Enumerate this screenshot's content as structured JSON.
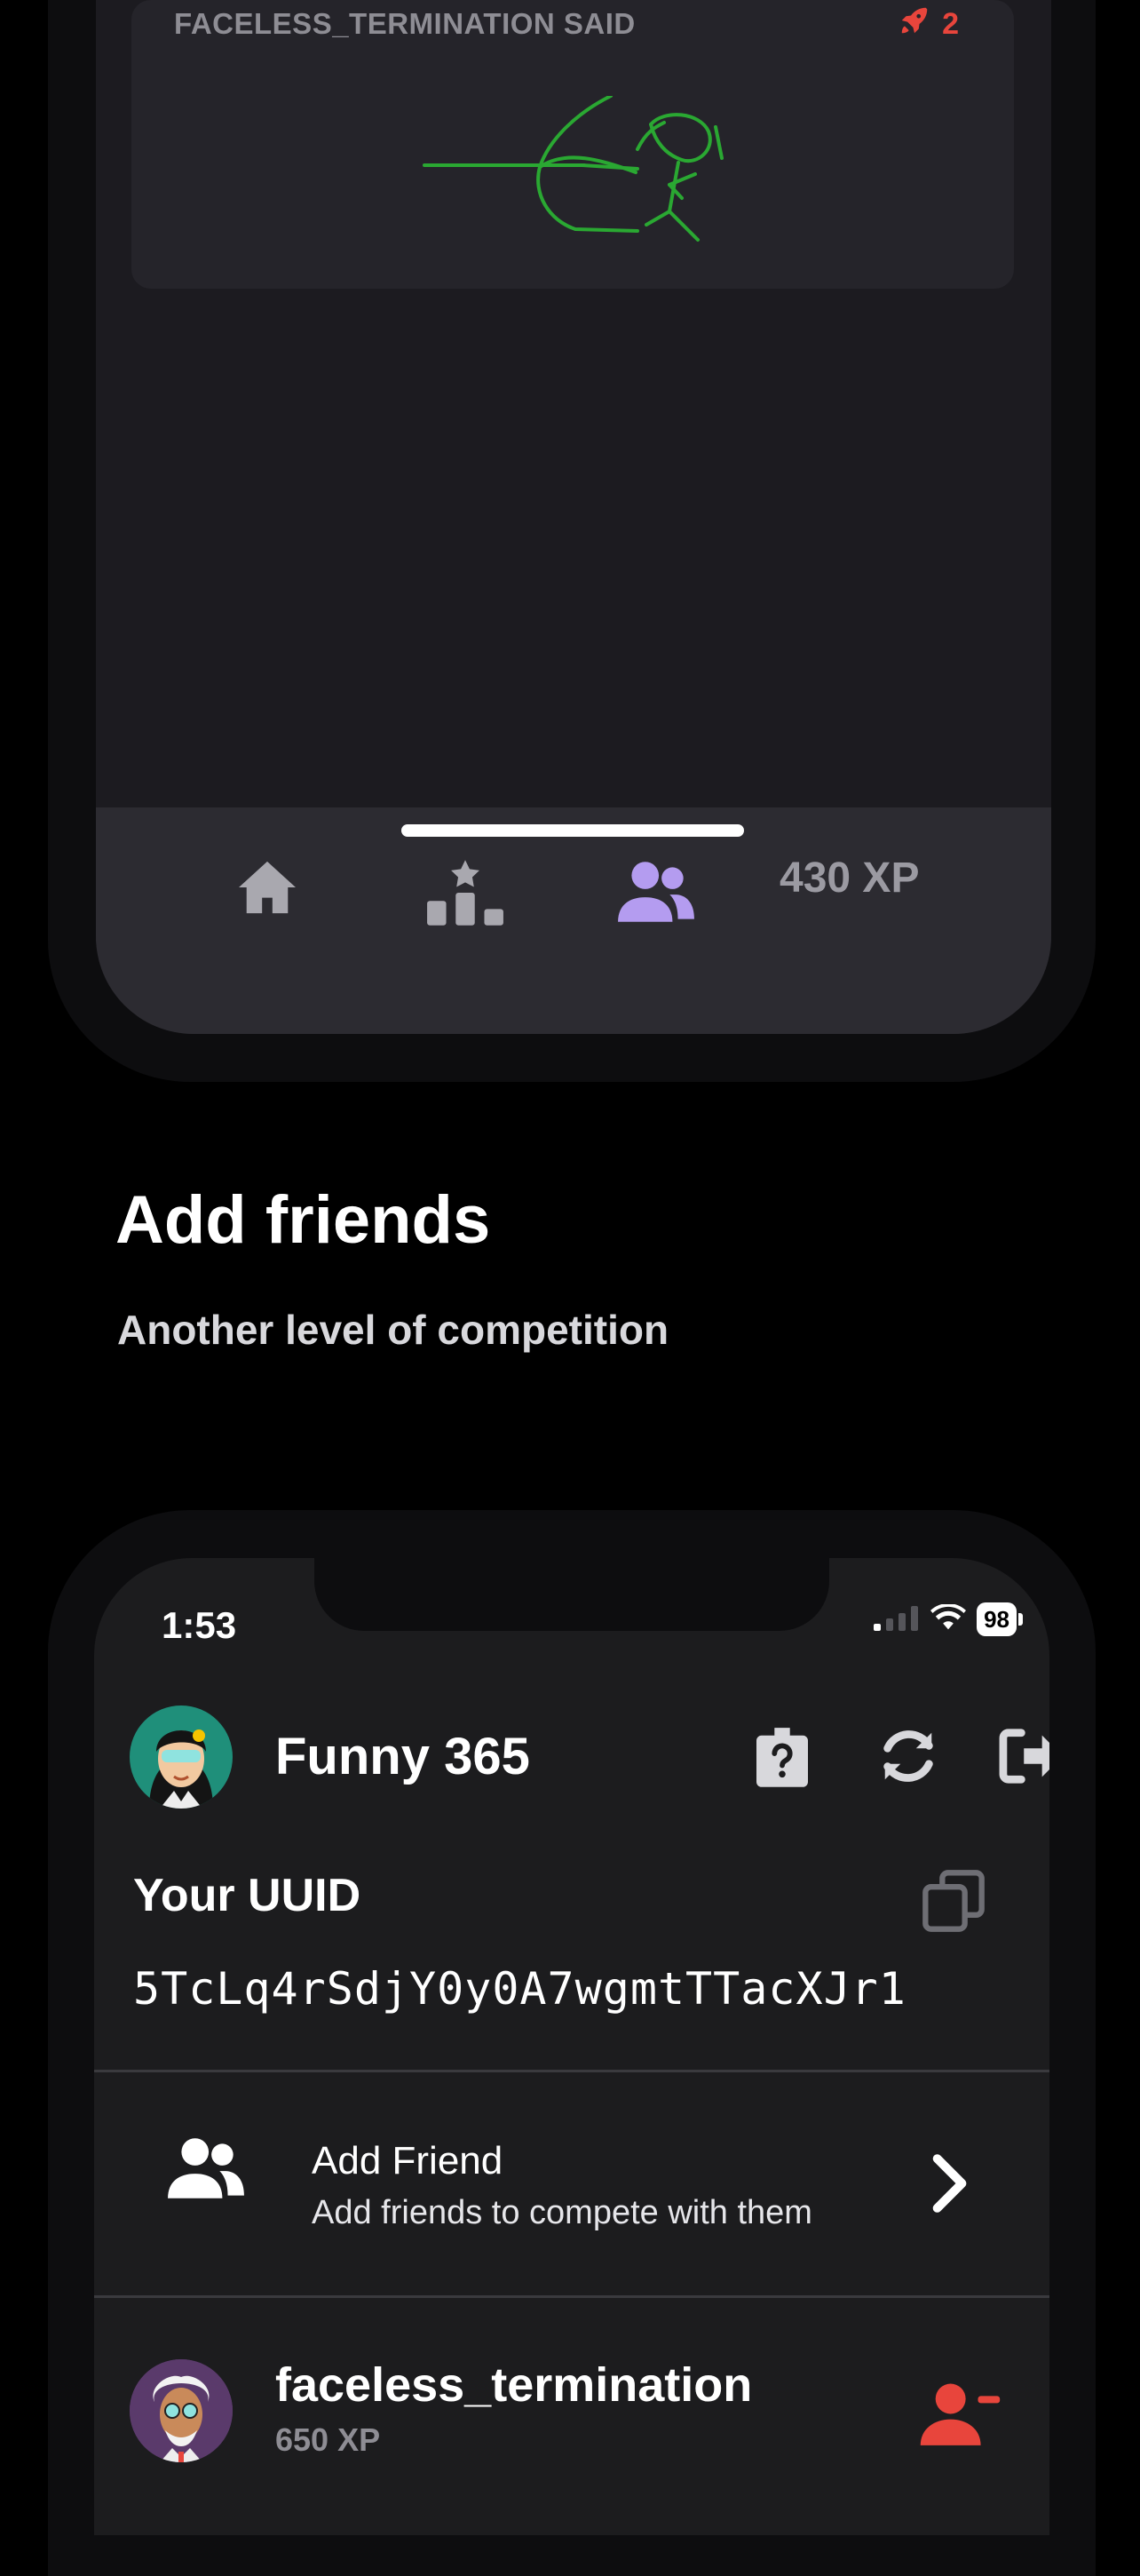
{
  "previous_screen": {
    "card": {
      "author": "FACELESS_TERMINATION SAID",
      "vote_count": "2"
    },
    "tabbar": {
      "tabs": [
        "home-icon",
        "leaderboard-icon",
        "friends-icon"
      ],
      "xp_label": "430 XP"
    }
  },
  "section": {
    "title": "Add friends",
    "subtitle": "Another level of competition"
  },
  "friends_screen": {
    "status_bar": {
      "time": "1:53",
      "battery": "98"
    },
    "profile": {
      "name": "Funny 365"
    },
    "uuid": {
      "label": "Your UUID",
      "value": "5TcLq4rSdjY0y0A7wgmtTTacXJr1"
    },
    "add_friend": {
      "title": "Add Friend",
      "subtitle": "Add friends to compete with them"
    },
    "friends": [
      {
        "name": "faceless_termination",
        "xp": "650 XP"
      }
    ],
    "colors": {
      "accent_purple": "#b49cf0",
      "danger_red": "#e8453c",
      "screen_bg": "#1c1c1e"
    }
  }
}
